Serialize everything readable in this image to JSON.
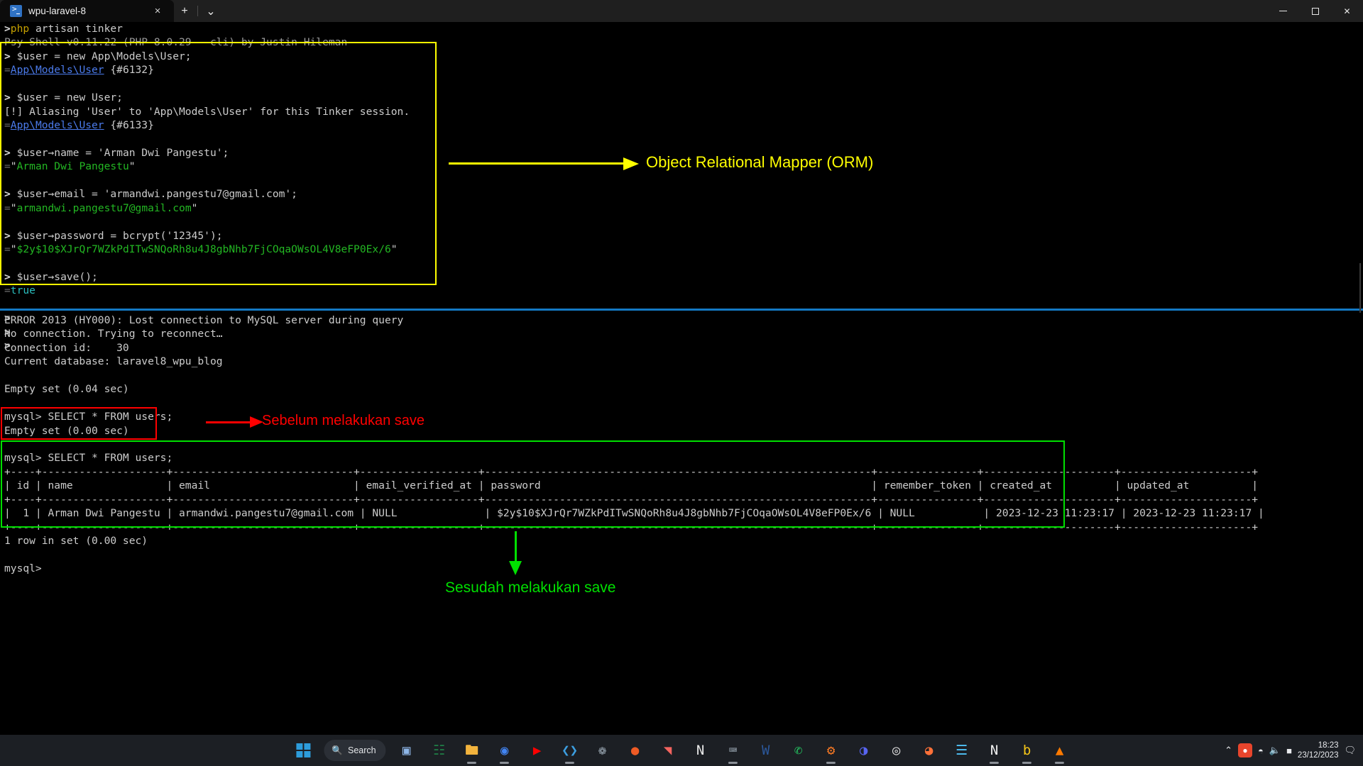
{
  "window": {
    "tab_title": "wpu-laravel-8",
    "tab_icon": "terminal-icon",
    "close_label": "×",
    "new_tab_label": "+",
    "dropdown_label": "⌄",
    "minimize_label": "─",
    "maximize_label": "☐",
    "window_close_label": "✕"
  },
  "terminal": {
    "tinker": {
      "lines": [
        {
          "marker": ">",
          "marker_color": "white",
          "segments": [
            {
              "t": "php",
              "c": "yellow"
            },
            {
              "t": " artisan tinker",
              "c": "white"
            }
          ]
        },
        {
          "marker": "",
          "segments": [
            {
              "t": "Psy Shell v0.11.22 (PHP 8.0.29 — cli) by Justin Hileman",
              "c": "gray"
            }
          ]
        },
        {
          "marker": ">",
          "segments": [
            {
              "t": " $user = new App\\Models\\User;",
              "c": "white"
            }
          ]
        },
        {
          "marker": "=",
          "segments": [
            {
              "t": "App\\Models\\User",
              "c": "blue"
            },
            {
              "t": " {#6132}",
              "c": "white"
            }
          ]
        },
        {
          "marker": "",
          "segments": []
        },
        {
          "marker": ">",
          "segments": [
            {
              "t": " $user = new User;",
              "c": "white"
            }
          ]
        },
        {
          "marker": "",
          "segments": [
            {
              "t": "[!] Aliasing 'User' to 'App\\Models\\User' for this Tinker session.",
              "c": "white"
            }
          ]
        },
        {
          "marker": "=",
          "segments": [
            {
              "t": "App\\Models\\User",
              "c": "blue"
            },
            {
              "t": " {#6133}",
              "c": "white"
            }
          ]
        },
        {
          "marker": "",
          "segments": []
        },
        {
          "marker": ">",
          "segments": [
            {
              "t": " $user→name = 'Arman Dwi Pangestu';",
              "c": "white"
            }
          ]
        },
        {
          "marker": "=",
          "segments": [
            {
              "t": "\"",
              "c": "white"
            },
            {
              "t": "Arman Dwi Pangestu",
              "c": "green"
            },
            {
              "t": "\"",
              "c": "white"
            }
          ]
        },
        {
          "marker": "",
          "segments": []
        },
        {
          "marker": ">",
          "segments": [
            {
              "t": " $user→email = 'armandwi.pangestu7@gmail.com';",
              "c": "white"
            }
          ]
        },
        {
          "marker": "=",
          "segments": [
            {
              "t": "\"",
              "c": "white"
            },
            {
              "t": "armandwi.pangestu7@gmail.com",
              "c": "green"
            },
            {
              "t": "\"",
              "c": "white"
            }
          ]
        },
        {
          "marker": "",
          "segments": []
        },
        {
          "marker": ">",
          "segments": [
            {
              "t": " $user→password = bcrypt('12345');",
              "c": "white"
            }
          ]
        },
        {
          "marker": "=",
          "segments": [
            {
              "t": "\"",
              "c": "white"
            },
            {
              "t": "$2y$10$XJrQr7WZkPdITwSNQoRh8u4J8gbNhb7FjCOqaOWsOL4V8eFP0Ex/6",
              "c": "green"
            },
            {
              "t": "\"",
              "c": "white"
            }
          ]
        },
        {
          "marker": "",
          "segments": []
        },
        {
          "marker": ">",
          "segments": [
            {
              "t": " $user→save();",
              "c": "white"
            }
          ]
        },
        {
          "marker": "=",
          "segments": [
            {
              "t": "true",
              "c": "cyan"
            }
          ]
        },
        {
          "marker": "",
          "segments": []
        },
        {
          "marker": ">",
          "segments": []
        },
        {
          "marker": ">",
          "segments": []
        },
        {
          "marker": ">",
          "segments": []
        }
      ]
    },
    "mysql": {
      "lines": [
        "ERROR 2013 (HY000): Lost connection to MySQL server during query",
        "No connection. Trying to reconnect…",
        "Connection id:    30",
        "Current database: laravel8_wpu_blog",
        "",
        "Empty set (0.04 sec)",
        "",
        "mysql> SELECT * FROM users;",
        "Empty set (0.00 sec)",
        "",
        "mysql> SELECT * FROM users;",
        "+----+--------------------+-----------------------------+-------------------+--------------------------------------------------------------+----------------+---------------------+---------------------+",
        "| id | name               | email                       | email_verified_at | password                                                     | remember_token | created_at          | updated_at          |",
        "+----+--------------------+-----------------------------+-------------------+--------------------------------------------------------------+----------------+---------------------+---------------------+",
        "|  1 | Arman Dwi Pangestu | armandwi.pangestu7@gmail.com | NULL              | $2y$10$XJrQr7WZkPdITwSNQoRh8u4J8gbNhb7FjCOqaOWsOL4V8eFP0Ex/6 | NULL           | 2023-12-23 11:23:17 | 2023-12-23 11:23:17 |",
        "+----+--------------------+-----------------------------+-------------------+--------------------------------------------------------------+----------------+---------------------+---------------------+",
        "1 row in set (0.00 sec)",
        "",
        "mysql>"
      ],
      "table": {
        "columns": [
          "id",
          "name",
          "email",
          "email_verified_at",
          "password",
          "remember_token",
          "created_at",
          "updated_at"
        ],
        "rows": [
          [
            "1",
            "Arman Dwi Pangestu",
            "armandwi.pangestu7@gmail.com",
            "NULL",
            "$2y$10$XJrQr7WZkPdITwSNQoRh8u4J8gbNhb7FjCOqaOWsOL4V8eFP0Ex/6",
            "NULL",
            "2023-12-23 11:23:17",
            "2023-12-23 11:23:17"
          ]
        ],
        "footer": "1 row in set (0.00 sec)"
      }
    }
  },
  "annotations": {
    "orm": {
      "text": "Object Relational Mapper (ORM)",
      "color": "#ffff00"
    },
    "before_save": {
      "text": "Sebelum melakukan save",
      "color": "#ff0000"
    },
    "after_save": {
      "text": "Sesudah melakukan save",
      "color": "#00e000"
    }
  },
  "taskbar": {
    "search_placeholder": "Search",
    "search_icon": "search-icon",
    "start_icon": "windows-logo-icon",
    "items": [
      {
        "name": "task-view",
        "glyph": "▣",
        "color": "#8fb7e8",
        "active": false
      },
      {
        "name": "excel",
        "glyph": "☷",
        "color": "#1f7a45",
        "active": false
      },
      {
        "name": "file-explorer",
        "glyph": "🖿",
        "color": "#f2b33d",
        "active": true
      },
      {
        "name": "google-chrome",
        "glyph": "◉",
        "color": "#4285f4",
        "active": true
      },
      {
        "name": "youtube",
        "glyph": "▶",
        "color": "#ff0000",
        "active": false
      },
      {
        "name": "visual-studio-code",
        "glyph": "❮❯",
        "color": "#3c9ee0",
        "active": true
      },
      {
        "name": "steam",
        "glyph": "❁",
        "color": "#9aa7b2",
        "active": false
      },
      {
        "name": "postman",
        "glyph": "●",
        "color": "#ef5b25",
        "active": false
      },
      {
        "name": "laravel",
        "glyph": "◥",
        "color": "#f4645f",
        "active": false
      },
      {
        "name": "notion-alt",
        "glyph": "N",
        "color": "#e8e8e8",
        "active": false
      },
      {
        "name": "terminal",
        "glyph": "⌨",
        "color": "#9aa7b2",
        "active": true
      },
      {
        "name": "microsoft-word",
        "glyph": "W",
        "color": "#2b579a",
        "active": false
      },
      {
        "name": "whatsapp",
        "glyph": "✆",
        "color": "#25d366",
        "active": false
      },
      {
        "name": "xampp",
        "glyph": "⚙",
        "color": "#fb7a24",
        "active": true
      },
      {
        "name": "discord",
        "glyph": "◑",
        "color": "#5865f2",
        "active": false
      },
      {
        "name": "browser-alt",
        "glyph": "◎",
        "color": "#dcdcdc",
        "active": false
      },
      {
        "name": "firefox",
        "glyph": "◕",
        "color": "#ff7139",
        "active": false
      },
      {
        "name": "notepad",
        "glyph": "☰",
        "color": "#4fc3f7",
        "active": false
      },
      {
        "name": "notion",
        "glyph": "N",
        "color": "#f0f0f0",
        "active": true
      },
      {
        "name": "bitly",
        "glyph": "b",
        "color": "#f5c518",
        "active": true
      },
      {
        "name": "vlc-media-player",
        "glyph": "▲",
        "color": "#ff7a00",
        "active": true
      }
    ],
    "tray": {
      "chevron": "⌃",
      "icons": [
        "◆",
        "⬤",
        "▲",
        "■"
      ],
      "wifi_icon": "wifi-icon",
      "volume_icon": "volume-icon",
      "battery_icon": "battery-icon",
      "time": "18:23",
      "date": "23/12/2023",
      "notification_icon": "notification-icon"
    }
  }
}
